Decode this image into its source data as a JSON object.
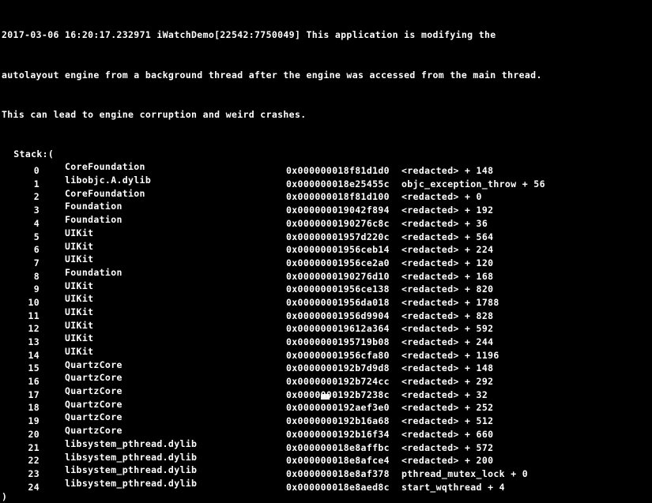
{
  "console": {
    "background_color": "#000000",
    "text_color": "#ffffff",
    "log": {
      "timestamp": "2017-03-06 16:20:17.232971",
      "process": "iWatchDemo[22542:7750049]",
      "message_line_1": "2017-03-06 16:20:17.232971 iWatchDemo[22542:7750049] This application is modifying the",
      "message_line_2": "autolayout engine from a background thread after the engine was accessed from the main thread.",
      "message_line_3": "This can lead to engine corruption and weird crashes.",
      "stack_open": " Stack:(",
      "stack_close": ")"
    },
    "frames": [
      {
        "index": "0",
        "library": "CoreFoundation",
        "address": "0x000000018f81d1d0",
        "symbol": "<redacted>",
        "plus": "+",
        "offset": "148"
      },
      {
        "index": "1",
        "library": "libobjc.A.dylib",
        "address": "0x000000018e25455c",
        "symbol": "objc_exception_throw",
        "plus": "+",
        "offset": "56"
      },
      {
        "index": "2",
        "library": "CoreFoundation",
        "address": "0x000000018f81d100",
        "symbol": "<redacted>",
        "plus": "+",
        "offset": "0"
      },
      {
        "index": "3",
        "library": "Foundation",
        "address": "0x000000019042f894",
        "symbol": "<redacted>",
        "plus": "+",
        "offset": "192"
      },
      {
        "index": "4",
        "library": "Foundation",
        "address": "0x0000000190276c8c",
        "symbol": "<redacted>",
        "plus": "+",
        "offset": "36"
      },
      {
        "index": "5",
        "library": "UIKit",
        "address": "0x00000001957d220c",
        "symbol": "<redacted>",
        "plus": "+",
        "offset": "564"
      },
      {
        "index": "6",
        "library": "UIKit",
        "address": "0x00000001956ceb14",
        "symbol": "<redacted>",
        "plus": "+",
        "offset": "224"
      },
      {
        "index": "7",
        "library": "UIKit",
        "address": "0x00000001956ce2a0",
        "symbol": "<redacted>",
        "plus": "+",
        "offset": "120"
      },
      {
        "index": "8",
        "library": "Foundation",
        "address": "0x0000000190276d10",
        "symbol": "<redacted>",
        "plus": "+",
        "offset": "168"
      },
      {
        "index": "9",
        "library": "UIKit",
        "address": "0x00000001956ce138",
        "symbol": "<redacted>",
        "plus": "+",
        "offset": "820"
      },
      {
        "index": "10",
        "library": "UIKit",
        "address": "0x00000001956da018",
        "symbol": "<redacted>",
        "plus": "+",
        "offset": "1788"
      },
      {
        "index": "11",
        "library": "UIKit",
        "address": "0x00000001956d9904",
        "symbol": "<redacted>",
        "plus": "+",
        "offset": "828"
      },
      {
        "index": "12",
        "library": "UIKit",
        "address": "0x000000019612a364",
        "symbol": "<redacted>",
        "plus": "+",
        "offset": "592"
      },
      {
        "index": "13",
        "library": "UIKit",
        "address": "0x0000000195719b08",
        "symbol": "<redacted>",
        "plus": "+",
        "offset": "244"
      },
      {
        "index": "14",
        "library": "UIKit",
        "address": "0x00000001956cfa80",
        "symbol": "<redacted>",
        "plus": "+",
        "offset": "1196"
      },
      {
        "index": "15",
        "library": "QuartzCore",
        "address": "0x0000000192b7d9d8",
        "symbol": "<redacted>",
        "plus": "+",
        "offset": "148"
      },
      {
        "index": "16",
        "library": "QuartzCore",
        "address": "0x0000000192b724cc",
        "symbol": "<redacted>",
        "plus": "+",
        "offset": "292"
      },
      {
        "index": "17",
        "library": "QuartzCore",
        "address": "0x0000000192b7238c",
        "symbol": "<redacted>",
        "plus": "+",
        "offset": "32"
      },
      {
        "index": "18",
        "library": "QuartzCore",
        "address": "0x0000000192aef3e0",
        "symbol": "<redacted>",
        "plus": "+",
        "offset": "252"
      },
      {
        "index": "19",
        "library": "QuartzCore",
        "address": "0x0000000192b16a68",
        "symbol": "<redacted>",
        "plus": "+",
        "offset": "512"
      },
      {
        "index": "20",
        "library": "QuartzCore",
        "address": "0x0000000192b16f34",
        "symbol": "<redacted>",
        "plus": "+",
        "offset": "660"
      },
      {
        "index": "21",
        "library": "libsystem_pthread.dylib",
        "address": "0x000000018e8affbc",
        "symbol": "<redacted>",
        "plus": "+",
        "offset": "572"
      },
      {
        "index": "22",
        "library": "libsystem_pthread.dylib",
        "address": "0x000000018e8afce4",
        "symbol": "<redacted>",
        "plus": "+",
        "offset": "200"
      },
      {
        "index": "23",
        "library": "libsystem_pthread.dylib",
        "address": "0x000000018e8af378",
        "symbol": "pthread_mutex_lock",
        "plus": "+",
        "offset": "0"
      },
      {
        "index": "24",
        "library": "libsystem_pthread.dylib",
        "address": "0x000000018e8aed8c",
        "symbol": "start_wqthread",
        "plus": "+",
        "offset": "4"
      }
    ]
  }
}
